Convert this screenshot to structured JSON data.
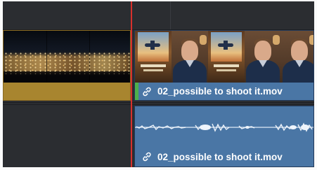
{
  "timeline": {
    "clips": [
      {
        "track": "V1",
        "name": "",
        "kind": "video",
        "thumbnail": "night-city-lights",
        "color": "#a8852f"
      },
      {
        "track": "V1",
        "name": "02_possible to shoot it.mov",
        "kind": "video",
        "thumbnail": "interview-man-with-poster",
        "color": "#4a76a5",
        "linked": true
      },
      {
        "track": "A1",
        "name": "02_possible to shoot it.mov",
        "kind": "audio",
        "color": "#4a76a5",
        "linked": true
      }
    ],
    "playhead_color": "#d8302c",
    "icons": {
      "link": "link-icon"
    }
  }
}
